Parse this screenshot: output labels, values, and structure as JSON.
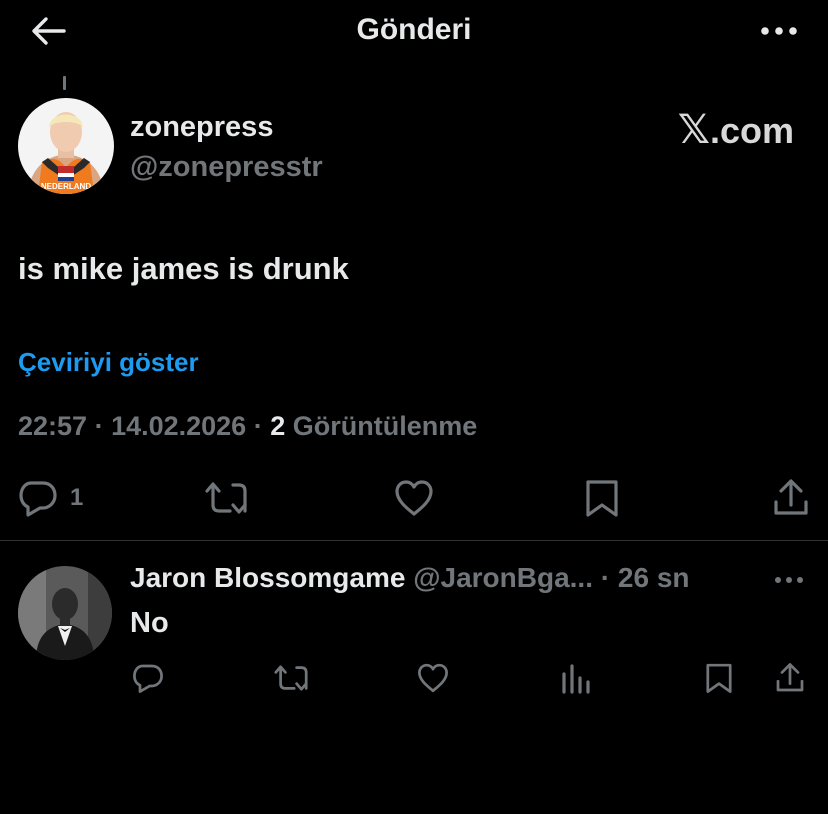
{
  "header": {
    "title": "Gönderi",
    "back_icon": "arrow-left-icon",
    "more_icon": "more-horizontal-icon"
  },
  "post": {
    "author_name": "zonepress",
    "author_handle": "@zonepresstr",
    "source_logo_glyph": "𝕏",
    "source_logo_text": ".com",
    "avatar_jersey_text": "NEDERLAND",
    "text": "is mike james is drunk",
    "translate_label": "Çeviriyi göster",
    "time": "22:57",
    "sep1": " · ",
    "date": "14.02.2026",
    "sep2": " · ",
    "views_count": "2",
    "views_label": " Görüntülenme",
    "actions": {
      "reply_count": "1",
      "icons": [
        "reply-icon",
        "retweet-icon",
        "like-icon",
        "bookmark-icon",
        "share-icon"
      ]
    }
  },
  "reply": {
    "author_name": "Jaron Blossomgame",
    "author_handle": "@JaronBga...",
    "time_sep": " · ",
    "time": "26 sn",
    "text": "No",
    "icons": [
      "reply-icon",
      "retweet-icon",
      "like-icon",
      "views-icon",
      "bookmark-icon",
      "share-icon"
    ]
  },
  "colors": {
    "background": "#000000",
    "text": "#e7e9ea",
    "muted": "#71767b",
    "accent": "#1d9bf0",
    "divider": "#2f3336"
  }
}
